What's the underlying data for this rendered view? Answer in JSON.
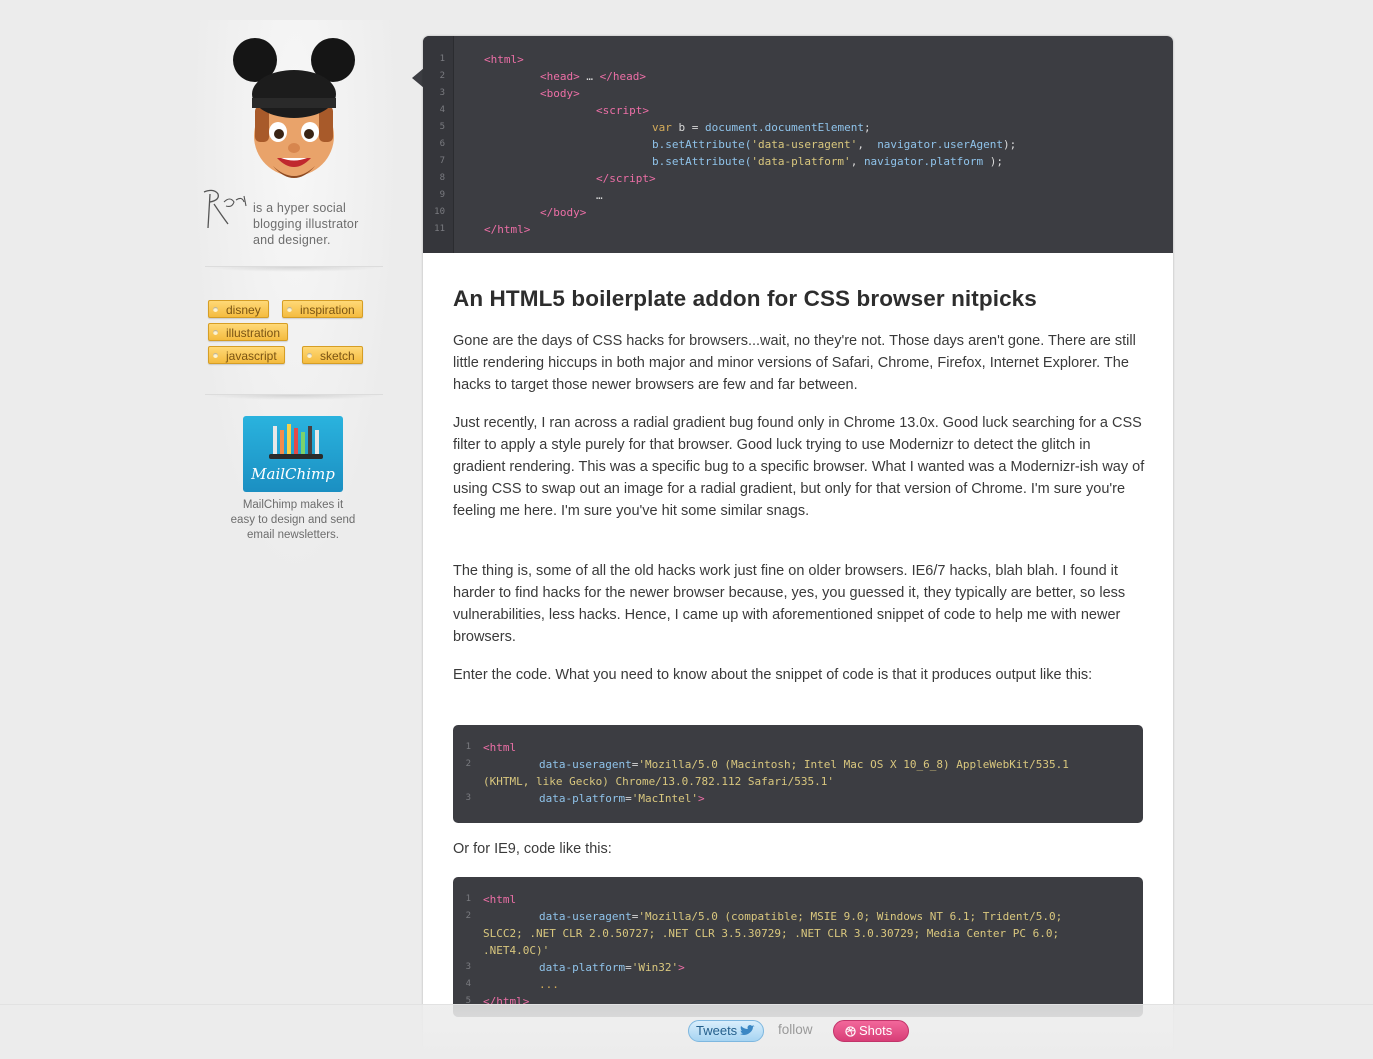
{
  "sidebar": {
    "signature_text": "Rogie",
    "bio": "is a hyper social blogging illustrator and designer.",
    "tags": [
      "disney",
      "inspiration",
      "illustration",
      "javascript",
      "sketch"
    ],
    "sponsor": {
      "logo_text": "MailChimp",
      "text": "MailChimp makes it easy to design and send email newsletters."
    }
  },
  "hero_code": {
    "line_numbers": [
      "1",
      "2",
      "3",
      "4",
      "5",
      "6",
      "7",
      "8",
      "9",
      "10",
      "11"
    ]
  },
  "post": {
    "title": "An HTML5 boilerplate addon for CSS browser nitpicks",
    "paragraphs": [
      "Gone are the days of CSS hacks for browsers...wait, no they're not. Those days aren't gone. There are still little rendering hiccups in both major and minor versions of Safari, Chrome, Firefox, Internet Explorer. The hacks to target those newer browsers are few and far between.",
      "Just recently, I ran across a radial gradient bug found only in Chrome 13.0x. Good luck searching for a CSS filter to apply a style purely for that browser. Good luck trying to use Modernizr to detect the glitch in gradient rendering. This was a specific bug to a specific browser. What I wanted was a Modernizr-ish way of using CSS to swap out an image for a radial gradient, but only for that version of Chrome. I'm sure you're feeling me here. I'm sure you've hit some similar snags.",
      "The thing is, some of all the old hacks work just fine on older browsers. IE6/7 hacks, blah blah. I found it harder to find hacks for the newer browser because, yes, you guessed it, they typically are better, so less vulnerabilities, less hacks. Hence, I came up with aforementioned snippet of code to help me with newer browsers.",
      "Enter the code. What you need to know about the snippet of code is that it produces output like this:",
      "Or for IE9, code like this:"
    ],
    "code1": {
      "line_numbers": [
        "1",
        "2",
        "",
        "3"
      ],
      "ua_value": "'Mozilla/5.0 (Macintosh; Intel Mac OS X 10_6_8) AppleWebKit/535.1",
      "ua_value_cont": "(KHTML, like Gecko) Chrome/13.0.782.112 Safari/535.1'",
      "platform_value": "'MacIntel'"
    },
    "code2": {
      "line_numbers": [
        "1",
        "2",
        "",
        "",
        "3",
        "4",
        "5"
      ],
      "ua_value": "'Mozilla/5.0 (compatible; MSIE 9.0; Windows NT 6.1; Trident/5.0;",
      "ua_value_cont1": "SLCC2; .NET CLR 2.0.50727; .NET CLR 3.5.30729; .NET CLR 3.0.30729; Media Center PC 6.0;",
      "ua_value_cont2": ".NET4.0C)'",
      "platform_value": "'Win32'",
      "ellipsis": "..."
    }
  },
  "footer": {
    "tweets_label": "Tweets",
    "follow_label": "follow",
    "shots_label": "Shots"
  }
}
